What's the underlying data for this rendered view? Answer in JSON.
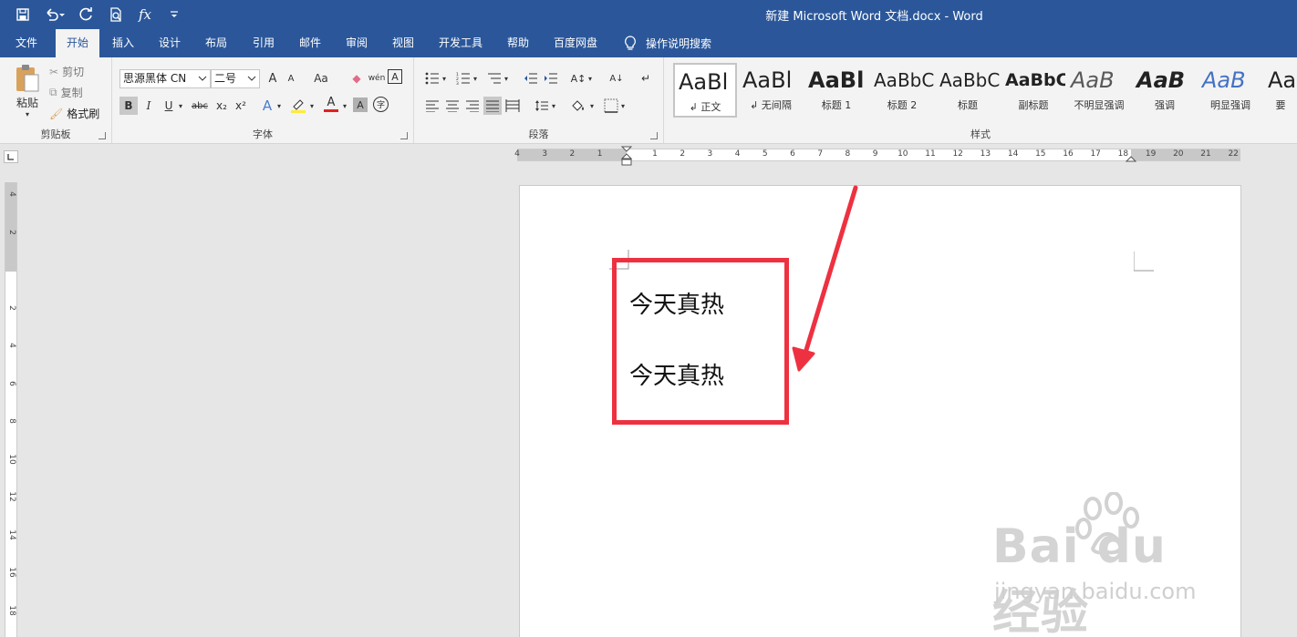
{
  "window": {
    "title": "新建 Microsoft Word 文档.docx  -  Word"
  },
  "quick_access": {
    "fx_label": "fx"
  },
  "tabs": [
    "文件",
    "开始",
    "插入",
    "设计",
    "布局",
    "引用",
    "邮件",
    "审阅",
    "视图",
    "开发工具",
    "帮助",
    "百度网盘"
  ],
  "active_tab": "开始",
  "tell_me": "操作说明搜索",
  "clipboard": {
    "paste": "粘贴",
    "cut": "剪切",
    "copy": "复制",
    "format_painter": "格式刷",
    "label": "剪贴板"
  },
  "font": {
    "name": "思源黑体 CN",
    "size": "二号",
    "label": "字体",
    "bold": "B",
    "italic": "I",
    "underline": "U",
    "strike": "abc",
    "sub": "x₂",
    "sup": "x²",
    "case": "Aa",
    "grow": "A",
    "shrink": "A",
    "phonetic": "wén",
    "border_char": "A",
    "text_effect": "A",
    "font_color": "A",
    "shade": "A",
    "enclose": "字"
  },
  "paragraph": {
    "label": "段落"
  },
  "styles": {
    "label": "样式",
    "items": [
      {
        "preview": "AaBl",
        "name": "正文",
        "weight": "normal",
        "color": "#000000"
      },
      {
        "preview": "AaBl",
        "name": "无间隔",
        "weight": "normal",
        "color": "#000000"
      },
      {
        "preview": "AaBl",
        "name": "标题 1",
        "weight": "bold",
        "color": "#000000"
      },
      {
        "preview": "AaBbC",
        "name": "标题 2",
        "weight": "normal",
        "color": "#000000"
      },
      {
        "preview": "AaBbC",
        "name": "标题",
        "weight": "normal",
        "color": "#000000"
      },
      {
        "preview": "AaBbC",
        "name": "副标题",
        "weight": "bold",
        "color": "#000000"
      },
      {
        "preview": "AaB",
        "name": "不明显强调",
        "weight": "normal",
        "color": "#595959"
      },
      {
        "preview": "AaB",
        "name": "强调",
        "weight": "bold",
        "color": "#000000"
      },
      {
        "preview": "AaB",
        "name": "明显强调",
        "weight": "normal",
        "color": "#4472c4"
      },
      {
        "preview": "Aa",
        "name": "要",
        "weight": "normal",
        "color": "#000000"
      }
    ]
  },
  "ruler": {
    "h_numbers": [
      "4",
      "3",
      "2",
      "1",
      "",
      "1",
      "2",
      "3",
      "4",
      "5",
      "6",
      "7",
      "8",
      "9",
      "10",
      "11",
      "12",
      "13",
      "14",
      "15",
      "16",
      "17",
      "18",
      "19",
      "20",
      "21",
      "22"
    ],
    "v_numbers": [
      "4",
      "2",
      "",
      "2",
      "4",
      "6",
      "8",
      "10",
      "12",
      "14",
      "16",
      "18"
    ]
  },
  "document": {
    "lines": [
      "今天真热",
      "今天真热"
    ]
  },
  "watermark": {
    "brand": "Bai du 经验",
    "url": "jingyan.baidu.com"
  },
  "colors": {
    "brand": "#2b579a",
    "highlight": "#ee3140"
  }
}
